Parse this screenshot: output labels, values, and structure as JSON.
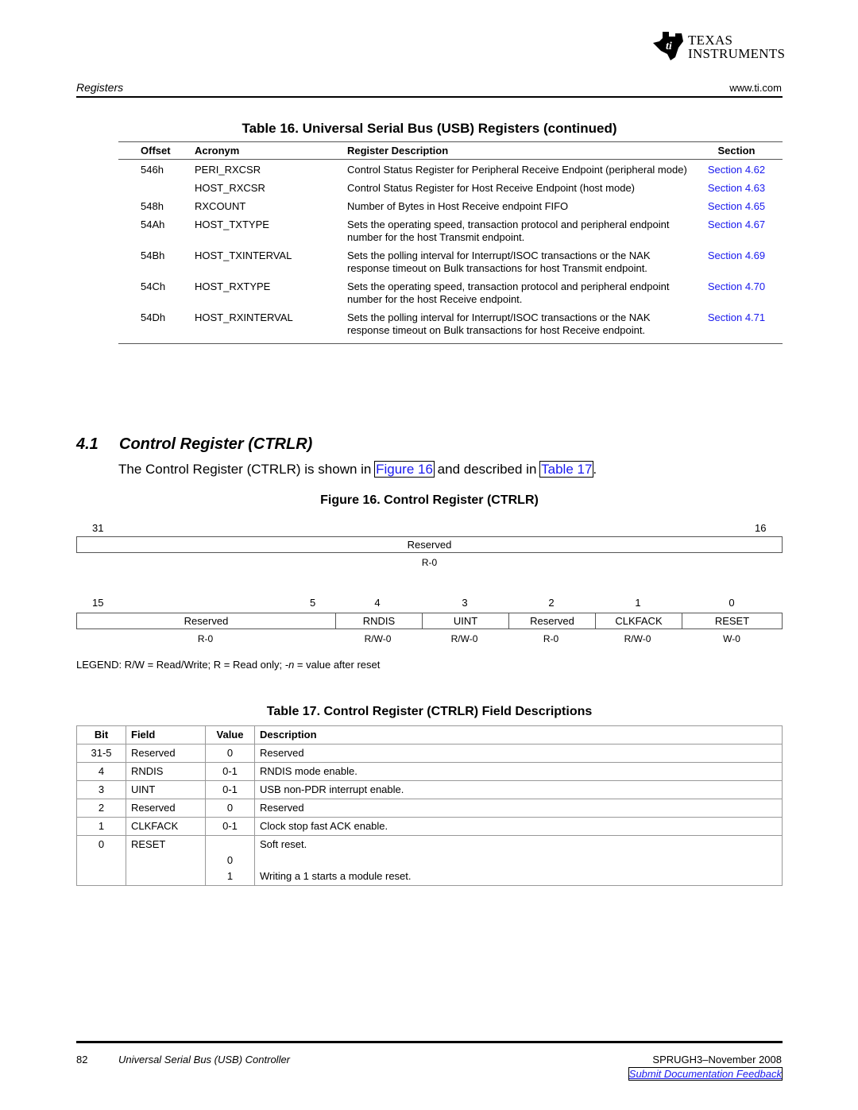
{
  "header": {
    "logo_line1": "Texas",
    "logo_line2": "Instruments",
    "section_label": "Registers",
    "site": "www.ti.com"
  },
  "table16": {
    "title": "Table 16. Universal Serial Bus (USB) Registers  (continued)",
    "columns": [
      "Offset",
      "Acronym",
      "Register Description",
      "Section"
    ],
    "rows": [
      {
        "offset": "546h",
        "acronym": "PERI_RXCSR",
        "description": "Control Status Register for Peripheral Receive Endpoint (peripheral mode)",
        "section": "Section 4.62"
      },
      {
        "offset": "",
        "acronym": "HOST_RXCSR",
        "description": "Control Status Register for Host Receive Endpoint (host mode)",
        "section": "Section 4.63"
      },
      {
        "offset": "548h",
        "acronym": "RXCOUNT",
        "description": "Number of Bytes in Host Receive endpoint FIFO",
        "section": "Section 4.65"
      },
      {
        "offset": "54Ah",
        "acronym": "HOST_TXTYPE",
        "description": "Sets the operating speed, transaction protocol and peripheral endpoint number for the host Transmit endpoint.",
        "section": "Section 4.67"
      },
      {
        "offset": "54Bh",
        "acronym": "HOST_TXINTERVAL",
        "description": "Sets the polling interval for Interrupt/ISOC transactions or the NAK response timeout on Bulk transactions for host Transmit endpoint.",
        "section": "Section 4.69"
      },
      {
        "offset": "54Ch",
        "acronym": "HOST_RXTYPE",
        "description": "Sets the operating speed, transaction protocol and peripheral endpoint number for the host Receive endpoint.",
        "section": "Section 4.70"
      },
      {
        "offset": "54Dh",
        "acronym": "HOST_RXINTERVAL",
        "description": "Sets the polling interval for Interrupt/ISOC transactions or the NAK response timeout on Bulk transactions for host Receive endpoint.",
        "section": "Section 4.71"
      }
    ]
  },
  "section": {
    "number": "4.1",
    "title": "Control Register (CTRLR)",
    "intro_prefix": "The Control Register (CTRLR) is shown in ",
    "intro_link1": "Figure 16",
    "intro_middle": " and described in ",
    "intro_link2": "Table 17",
    "intro_suffix": "."
  },
  "figure16": {
    "title": "Figure 16. Control Register (CTRLR)",
    "upper": {
      "bit_high": "31",
      "bit_low": "16",
      "field": "Reserved",
      "access": "R-0"
    },
    "lower": {
      "bit_labels": [
        "15",
        "5",
        "4",
        "3",
        "2",
        "1",
        "0"
      ],
      "fields": [
        {
          "name": "Reserved",
          "access": "R-0"
        },
        {
          "name": "RNDIS",
          "access": "R/W-0"
        },
        {
          "name": "UINT",
          "access": "R/W-0"
        },
        {
          "name": "Reserved",
          "access": "R-0"
        },
        {
          "name": "CLKFACK",
          "access": "R/W-0"
        },
        {
          "name": "RESET",
          "access": "W-0"
        }
      ]
    },
    "legend_prefix": "LEGEND: R/W = Read/Write; R = Read only; ",
    "legend_n": "-n",
    "legend_suffix": " = value after reset"
  },
  "table17": {
    "title": "Table 17. Control Register (CTRLR) Field Descriptions",
    "columns": [
      "Bit",
      "Field",
      "Value",
      "Description"
    ],
    "rows": [
      {
        "bit": "31-5",
        "field": "Reserved",
        "value": "0",
        "description": "Reserved"
      },
      {
        "bit": "4",
        "field": "RNDIS",
        "value": "0-1",
        "description": "RNDIS mode enable."
      },
      {
        "bit": "3",
        "field": "UINT",
        "value": "0-1",
        "description": "USB non-PDR interrupt enable."
      },
      {
        "bit": "2",
        "field": "Reserved",
        "value": "0",
        "description": "Reserved"
      },
      {
        "bit": "1",
        "field": "CLKFACK",
        "value": "0-1",
        "description": "Clock stop fast ACK enable."
      },
      {
        "bit": "0",
        "field": "RESET",
        "value": "",
        "description": "Soft reset."
      }
    ],
    "reset_subrows": [
      {
        "value": "0",
        "description": ""
      },
      {
        "value": "1",
        "description": "Writing a 1 starts a module reset."
      }
    ]
  },
  "footer": {
    "page_number": "82",
    "doc_title": "Universal Serial Bus (USB) Controller",
    "doc_id": "SPRUGH3–November 2008",
    "feedback_link": "Submit Documentation Feedback"
  }
}
